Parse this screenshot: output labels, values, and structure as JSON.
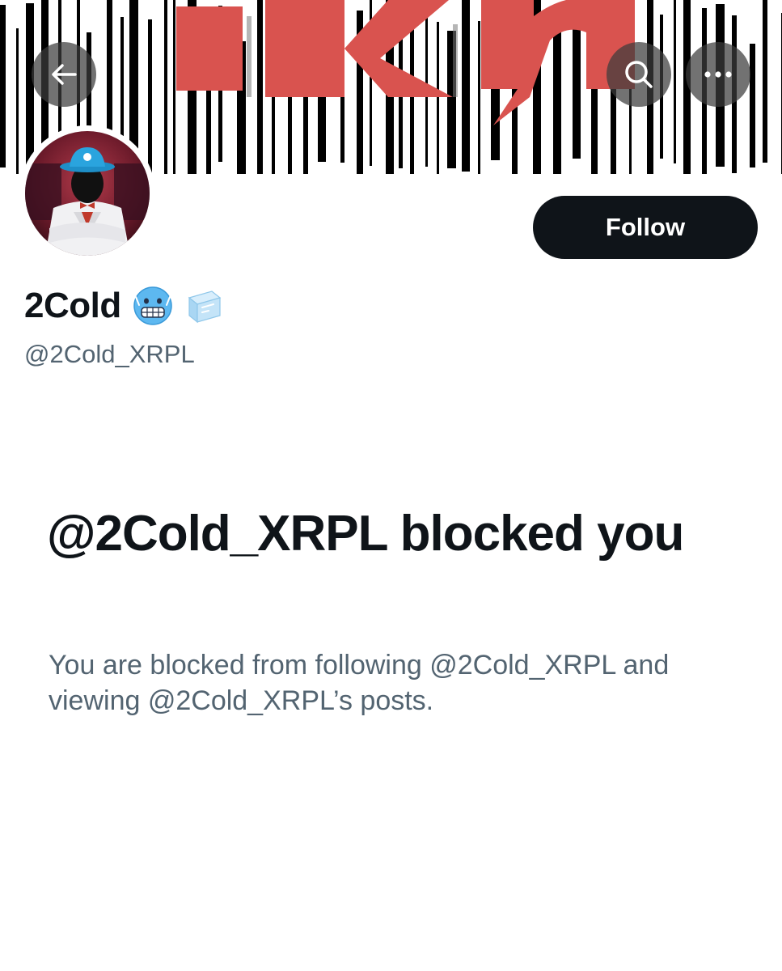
{
  "profile": {
    "display_name": "2Cold",
    "name_emoji_1": "🥶",
    "name_emoji_2": "🧊",
    "handle": "@2Cold_XRPL"
  },
  "header": {
    "back_icon": "arrow-left-icon",
    "search_icon": "search-icon",
    "more_icon": "more-horizontal-icon"
  },
  "actions": {
    "follow_label": "Follow"
  },
  "blocked": {
    "title": "@2Cold_XRPL blocked you",
    "description": "You are blocked from following @2Cold_XRPL and viewing @2Cold_XRPL’s posts."
  },
  "banner": {
    "text": "TKm",
    "colors": {
      "logo_red": "#d9534f",
      "bars": "#000000"
    }
  },
  "colors": {
    "primary_text": "#0f1419",
    "secondary_text": "#536471",
    "button_bg": "#0f1419",
    "button_text": "#ffffff"
  }
}
